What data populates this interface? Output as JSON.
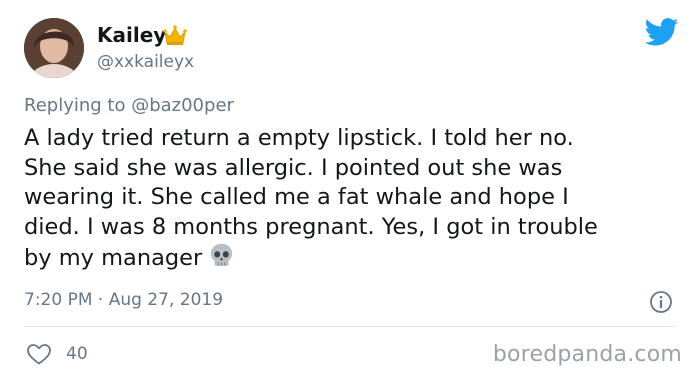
{
  "user": {
    "display_name": "Kailey",
    "handle": "@xxkaileyx"
  },
  "reply": {
    "prefix": "Replying to ",
    "mention": "@baz00per"
  },
  "tweet": {
    "text": "A lady tried return a empty lipstick. I told her no.\nShe said she was allergic. I pointed out she was\nwearing it. She called me a fat whale and hope I\ndied. I was 8 months pregnant. Yes, I got in trouble\nby my manager"
  },
  "meta": {
    "timestamp": "7:20 PM · Aug 27, 2019"
  },
  "engagement": {
    "likes": "40"
  },
  "watermark": "boredpanda.com",
  "icons": {
    "brand": "twitter-bird-icon",
    "badge": "crown-icon",
    "emoji": "skull-icon",
    "info": "info-icon",
    "like": "heart-icon"
  },
  "colors": {
    "twitter_blue": "#1da1f2",
    "secondary_text": "#657786",
    "primary_text": "#14171a"
  }
}
